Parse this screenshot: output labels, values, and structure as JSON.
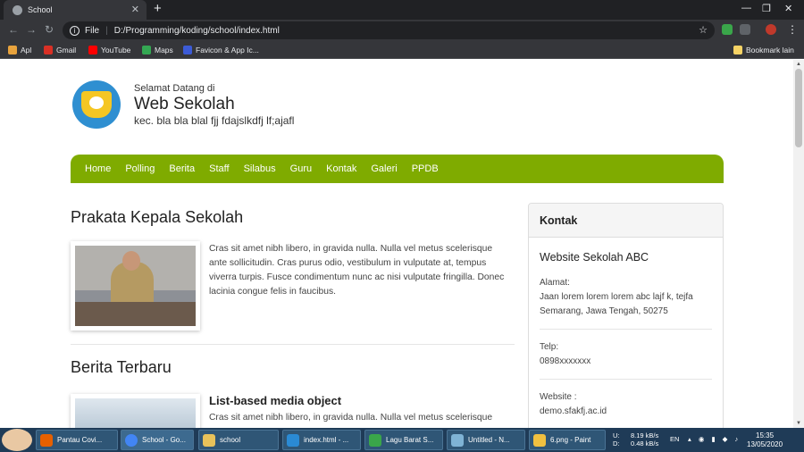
{
  "browser": {
    "tab_title": "School",
    "address_protocol": "File",
    "address_url": "D:/Programming/koding/school/index.html",
    "bookmarks": [
      {
        "label": "Apl",
        "color": "#e8a33d"
      },
      {
        "label": "Gmail",
        "color": "#d93025"
      },
      {
        "label": "YouTube",
        "color": "#ff0000"
      },
      {
        "label": "Maps",
        "color": "#34a853"
      },
      {
        "label": "Favicon & App Ic...",
        "color": "#3c5bd6"
      }
    ],
    "bookmark_right": "Bookmark lain"
  },
  "header": {
    "greeting": "Selamat Datang di",
    "site_name": "Web Sekolah",
    "tagline": "kec. bla bla blal fjj fdajslkdfj lf;ajafl"
  },
  "nav": {
    "items": [
      "Home",
      "Polling",
      "Berita",
      "Staff",
      "Silabus",
      "Guru",
      "Kontak",
      "Galeri",
      "PPDB"
    ]
  },
  "main": {
    "prakata_heading": "Prakata Kepala Sekolah",
    "prakata_text": "Cras sit amet nibh libero, in gravida nulla. Nulla vel metus scelerisque ante sollicitudin. Cras purus odio, vestibulum in vulputate at, tempus viverra turpis. Fusce condimentum nunc ac nisi vulputate fringilla. Donec lacinia congue felis in faucibus.",
    "berita_heading": "Berita Terbaru",
    "media_heading": "List-based media object",
    "media_text": "Cras sit amet nibh libero, in gravida nulla. Nulla vel metus scelerisque"
  },
  "sidebar": {
    "card_title": "Kontak",
    "org_name": "Website Sekolah ABC",
    "address_label": "Alamat:",
    "address_value": "Jaan lorem lorem lorem abc lajf k, tejfa Semarang, Jawa Tengah, 50275",
    "phone_label": "Telp:",
    "phone_value": "0898xxxxxxx",
    "website_label": "Website :",
    "website_value": "demo.sfakfj.ac.id"
  },
  "taskbar": {
    "apps": [
      {
        "label": "Pantau Covi...",
        "color": "#e66000"
      },
      {
        "label": "School - Go...",
        "color": "#4285f4"
      },
      {
        "label": "school",
        "color": "#e8c25a"
      },
      {
        "label": "index.html - ...",
        "color": "#2a8ad4"
      },
      {
        "label": "Lagu Barat S...",
        "color": "#3aa64a"
      },
      {
        "label": "Untitled - N...",
        "color": "#7fb3d5"
      },
      {
        "label": "6.png - Paint",
        "color": "#f0c040"
      }
    ],
    "net_up_label": "U:",
    "net_down_label": "D:",
    "net_up": "8.19 kB/s",
    "net_down": "0.48 kB/s",
    "lang": "EN",
    "time": "15:35",
    "date": "13/05/2020"
  }
}
